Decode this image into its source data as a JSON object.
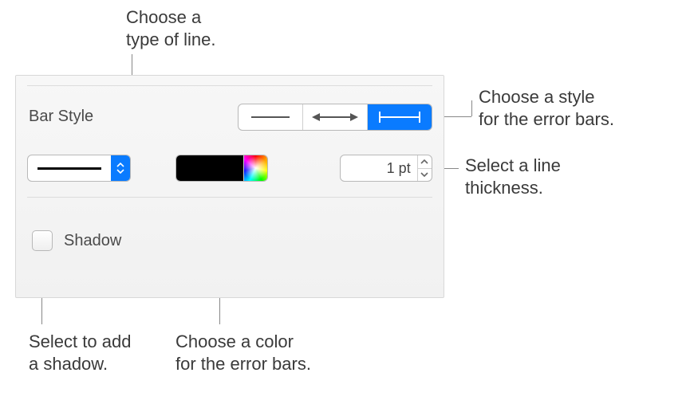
{
  "callouts": {
    "line_type": "Choose a\ntype of line.",
    "error_bar_style": "Choose a style\nfor the error bars.",
    "thickness": "Select a line\nthickness.",
    "shadow": "Select to add\na shadow.",
    "color": "Choose a color\nfor the error bars."
  },
  "panel": {
    "bar_style_label": "Bar Style",
    "thickness_value": "1 pt",
    "shadow_label": "Shadow",
    "color_swatch_hex": "#000000",
    "selected_style_index": 2
  },
  "icons": {
    "line_type_dropdown": "updown-chevrons-icon",
    "stepper_up": "chevron-up-icon",
    "stepper_down": "chevron-down-icon"
  }
}
